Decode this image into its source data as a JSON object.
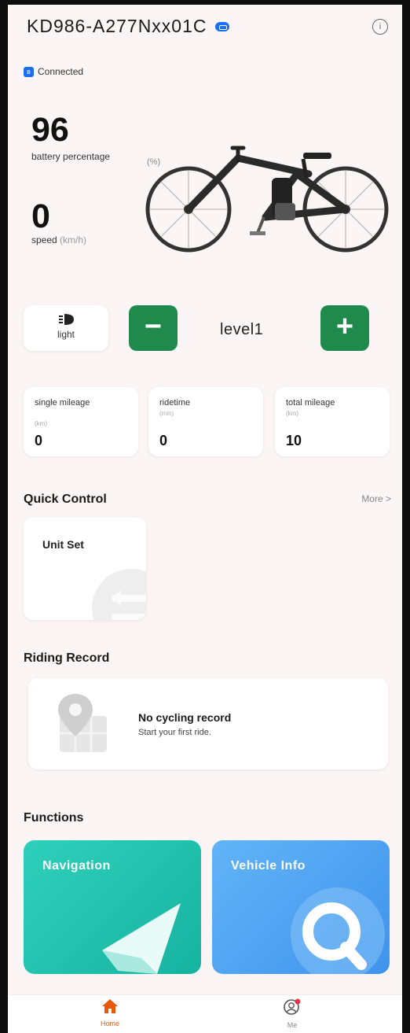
{
  "header": {
    "device_name": "KD986-A277Nxx01C"
  },
  "status": {
    "connection": "Connected"
  },
  "dashboard": {
    "battery_value": "96",
    "battery_label": "battery percentage",
    "battery_unit": "(%)",
    "speed_value": "0",
    "speed_label": "speed",
    "speed_unit": "(km/h)"
  },
  "assist": {
    "light_label": "light",
    "minus_label": "−",
    "plus_label": "+",
    "level": "level1"
  },
  "stats": [
    {
      "label": "single mileage",
      "unit": "(km)",
      "value": "0"
    },
    {
      "label": "ridetime",
      "unit": "(min)",
      "value": "0"
    },
    {
      "label": "total mileage",
      "unit": "(km)",
      "value": "10"
    }
  ],
  "quick_control": {
    "title": "Quick Control",
    "more": "More  >",
    "items": [
      {
        "label": "Unit Set"
      }
    ]
  },
  "riding_record": {
    "title": "Riding Record",
    "empty_title": "No cycling record",
    "empty_subtitle": "Start your first ride."
  },
  "functions": {
    "title": "Functions",
    "items": [
      {
        "label": "Navigation",
        "color": "#22c2ad"
      },
      {
        "label": "Vehicle Info",
        "color": "#4fa3f1"
      }
    ]
  },
  "bottom_nav": [
    {
      "label": "Home",
      "active": true
    },
    {
      "label": "Me",
      "active": false
    }
  ],
  "colors": {
    "accent_green": "#1f8a4c",
    "accent_orange": "#e8590c",
    "bt_blue": "#1d6df0"
  }
}
